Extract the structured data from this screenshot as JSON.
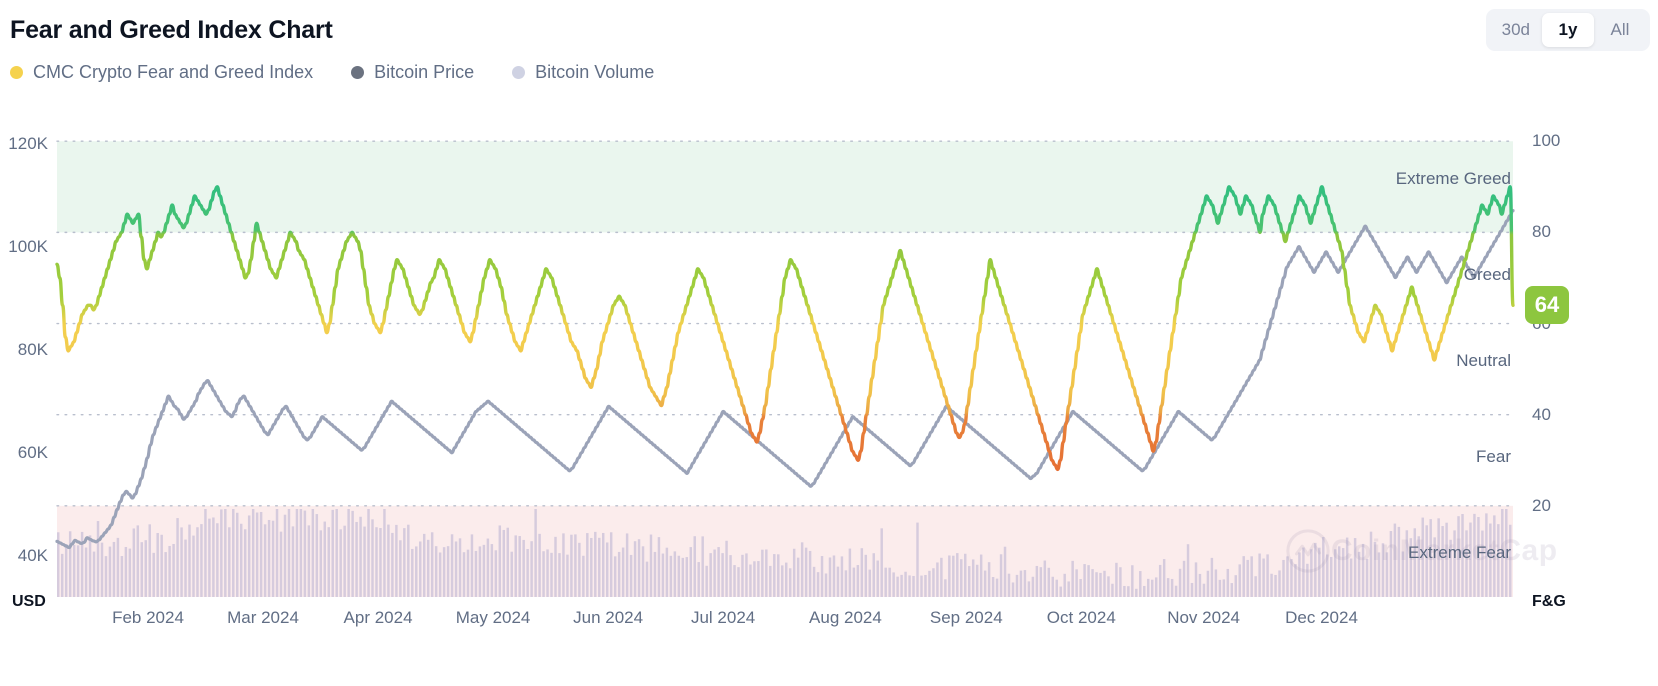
{
  "header": {
    "title": "Fear and Greed Index Chart"
  },
  "range_switch": {
    "options": [
      {
        "label": "30d",
        "active": false
      },
      {
        "label": "1y",
        "active": true
      },
      {
        "label": "All",
        "active": false
      }
    ]
  },
  "legend": {
    "items": [
      {
        "label": "CMC Crypto Fear and Greed Index",
        "color": "#f5d24e",
        "icon": "legend-dot-icon"
      },
      {
        "label": "Bitcoin Price",
        "color": "#6b7280",
        "icon": "legend-dot-icon"
      },
      {
        "label": "Bitcoin Volume",
        "color": "#cfd2e3",
        "icon": "legend-dot-icon"
      }
    ]
  },
  "current_value": {
    "value": "64",
    "badge_color": "#8dc63f"
  },
  "watermark": {
    "text": "CoinMarketCap"
  },
  "axes": {
    "left_unit": "USD",
    "right_unit": "F&G"
  },
  "chart_data": {
    "type": "line",
    "title": "Fear and Greed Index Chart",
    "xlabel": "",
    "ylabel": "USD",
    "y2label": "F&G",
    "grid": true,
    "legend_position": "top-left",
    "x_tick_labels": [
      "Feb 2024",
      "Mar 2024",
      "Apr 2024",
      "May 2024",
      "Jun 2024",
      "Jul 2024",
      "Aug 2024",
      "Sep 2024",
      "Oct 2024",
      "Nov 2024",
      "Dec 2024"
    ],
    "x_tick_fracs": [
      0.0625,
      0.1415,
      0.2205,
      0.2995,
      0.3785,
      0.4575,
      0.5415,
      0.6245,
      0.7035,
      0.7875,
      0.8685
    ],
    "y_left_ticks": [
      "120K",
      "100K",
      "80K",
      "60K",
      "40K"
    ],
    "y_left_values": [
      120000,
      100000,
      80000,
      60000,
      40000
    ],
    "y_left_lim": [
      32000,
      124000
    ],
    "y_right_ticks": [
      "100",
      "80",
      "60",
      "40",
      "20"
    ],
    "y_right_values": [
      100,
      80,
      60,
      40,
      20
    ],
    "y_right_lim": [
      0,
      104
    ],
    "zones": [
      {
        "label": "Extreme Greed",
        "range": [
          80,
          100
        ],
        "band_color": "#eaf6ee",
        "line_color": "#3cb878"
      },
      {
        "label": "Greed",
        "range": [
          60,
          80
        ],
        "band_color": "",
        "line_color": "#8dc63f"
      },
      {
        "label": "Neutral",
        "range": [
          40,
          60
        ],
        "band_color": "",
        "line_color": "#f3d04e"
      },
      {
        "label": "Fear",
        "range": [
          20,
          40
        ],
        "band_color": "",
        "line_color": "#e8833a"
      },
      {
        "label": "Extreme Fear",
        "range": [
          0,
          20
        ],
        "band_color": "#fbecec",
        "line_color": "#ea3943"
      }
    ],
    "series": [
      {
        "name": "CMC Crypto Fear and Greed Index",
        "axis": "right",
        "type": "line",
        "color_mode": "zone-gradient",
        "values": [
          73,
          70,
          64,
          57,
          54,
          55,
          56,
          58,
          60,
          62,
          63,
          64,
          64,
          63,
          64,
          66,
          68,
          70,
          72,
          74,
          76,
          78,
          79,
          80,
          82,
          84,
          83,
          82,
          83,
          84,
          79,
          74,
          72,
          74,
          76,
          78,
          80,
          79,
          80,
          82,
          84,
          86,
          84,
          83,
          82,
          81,
          82,
          84,
          86,
          88,
          87,
          86,
          85,
          84,
          85,
          87,
          89,
          90,
          88,
          86,
          84,
          82,
          80,
          78,
          76,
          74,
          72,
          70,
          71,
          74,
          78,
          82,
          80,
          78,
          76,
          74,
          72,
          71,
          70,
          72,
          74,
          76,
          78,
          80,
          79,
          78,
          76,
          75,
          74,
          72,
          70,
          68,
          66,
          64,
          62,
          60,
          58,
          60,
          64,
          68,
          72,
          74,
          76,
          78,
          79,
          80,
          79,
          78,
          76,
          72,
          68,
          64,
          62,
          60,
          59,
          58,
          60,
          63,
          66,
          69,
          72,
          74,
          73,
          72,
          70,
          68,
          66,
          64,
          63,
          62,
          63,
          65,
          67,
          69,
          70,
          72,
          74,
          73,
          72,
          70,
          68,
          66,
          64,
          62,
          60,
          58,
          57,
          56,
          58,
          61,
          64,
          67,
          70,
          72,
          74,
          73,
          72,
          70,
          68,
          65,
          62,
          60,
          58,
          56,
          55,
          54,
          56,
          58,
          60,
          62,
          64,
          66,
          68,
          70,
          72,
          71,
          70,
          68,
          66,
          64,
          62,
          60,
          58,
          56,
          55,
          54,
          52,
          50,
          48,
          47,
          46,
          48,
          50,
          53,
          56,
          58,
          60,
          62,
          64,
          65,
          66,
          65,
          64,
          62,
          60,
          58,
          56,
          54,
          52,
          50,
          48,
          46,
          45,
          44,
          43,
          42,
          44,
          46,
          49,
          52,
          55,
          58,
          60,
          62,
          64,
          66,
          68,
          70,
          72,
          71,
          70,
          68,
          66,
          64,
          62,
          60,
          58,
          56,
          54,
          52,
          50,
          48,
          46,
          44,
          42,
          40,
          38,
          36,
          35,
          34,
          36,
          39,
          42,
          46,
          50,
          54,
          58,
          62,
          66,
          70,
          72,
          74,
          73,
          72,
          70,
          68,
          66,
          64,
          62,
          60,
          58,
          56,
          54,
          52,
          50,
          48,
          46,
          44,
          42,
          40,
          38,
          36,
          34,
          32,
          31,
          30,
          32,
          36,
          40,
          44,
          48,
          52,
          56,
          60,
          64,
          66,
          68,
          70,
          72,
          74,
          76,
          74,
          72,
          70,
          68,
          66,
          64,
          62,
          60,
          58,
          56,
          54,
          52,
          50,
          48,
          46,
          44,
          42,
          40,
          38,
          36,
          35,
          36,
          38,
          42,
          46,
          50,
          54,
          58,
          62,
          66,
          70,
          74,
          72,
          70,
          68,
          66,
          64,
          62,
          60,
          58,
          56,
          54,
          52,
          50,
          48,
          46,
          44,
          42,
          40,
          38,
          36,
          34,
          32,
          30,
          29,
          28,
          30,
          34,
          38,
          42,
          46,
          50,
          54,
          58,
          62,
          64,
          66,
          68,
          70,
          72,
          70,
          68,
          66,
          64,
          62,
          60,
          58,
          56,
          54,
          52,
          50,
          48,
          46,
          44,
          42,
          40,
          38,
          36,
          34,
          32,
          34,
          38,
          42,
          46,
          50,
          54,
          58,
          62,
          66,
          70,
          72,
          74,
          76,
          78,
          80,
          82,
          84,
          86,
          88,
          87,
          86,
          84,
          82,
          84,
          86,
          88,
          90,
          89,
          88,
          86,
          84,
          86,
          88,
          87,
          86,
          84,
          82,
          80,
          84,
          86,
          88,
          87,
          86,
          84,
          82,
          80,
          78,
          80,
          82,
          84,
          86,
          88,
          87,
          86,
          84,
          82,
          84,
          86,
          88,
          90,
          88,
          86,
          84,
          82,
          80,
          78,
          76,
          72,
          68,
          64,
          62,
          60,
          58,
          57,
          56,
          58,
          60,
          62,
          64,
          63,
          62,
          60,
          58,
          56,
          54,
          56,
          58,
          60,
          62,
          64,
          66,
          68,
          66,
          64,
          62,
          60,
          58,
          56,
          54,
          52,
          54,
          56,
          58,
          60,
          62,
          64,
          66,
          68,
          70,
          72,
          74,
          76,
          78,
          80,
          82,
          84,
          86,
          85,
          84,
          86,
          88,
          87,
          86,
          84,
          86,
          88,
          90,
          64
        ]
      },
      {
        "name": "Bitcoin Price",
        "axis": "left",
        "type": "line",
        "color": "#9ba3b8",
        "values": [
          42800,
          42500,
          42200,
          41900,
          41600,
          42300,
          43000,
          42700,
          42400,
          42600,
          43500,
          43200,
          42900,
          42700,
          43100,
          43800,
          44500,
          45200,
          46000,
          47500,
          49000,
          50500,
          51800,
          52500,
          51900,
          51200,
          52000,
          53500,
          55000,
          57000,
          59000,
          61500,
          63500,
          65000,
          66500,
          68000,
          69500,
          71000,
          70000,
          69000,
          68500,
          67500,
          66500,
          67000,
          68000,
          69000,
          70000,
          71500,
          72500,
          73500,
          74000,
          73000,
          72000,
          71000,
          70000,
          69000,
          68000,
          67500,
          67000,
          68000,
          69500,
          70500,
          71000,
          70000,
          69000,
          68000,
          67000,
          66000,
          65000,
          64000,
          63500,
          64500,
          65500,
          66500,
          67500,
          68500,
          69000,
          68000,
          67000,
          66000,
          65000,
          64000,
          63000,
          62500,
          63000,
          64000,
          65000,
          66000,
          67000,
          66500,
          66000,
          65500,
          65000,
          64500,
          64000,
          63500,
          63000,
          62500,
          62000,
          61500,
          61000,
          60500,
          61000,
          62000,
          63000,
          64000,
          65000,
          66000,
          67000,
          68000,
          69000,
          70000,
          69500,
          69000,
          68500,
          68000,
          67500,
          67000,
          66500,
          66000,
          65500,
          65000,
          64500,
          64000,
          63500,
          63000,
          62500,
          62000,
          61500,
          61000,
          60500,
          60000,
          61000,
          62000,
          63000,
          64000,
          65000,
          66000,
          67000,
          68000,
          68500,
          69000,
          69500,
          70000,
          69500,
          69000,
          68500,
          68000,
          67500,
          67000,
          66500,
          66000,
          65500,
          65000,
          64500,
          64000,
          63500,
          63000,
          62500,
          62000,
          61500,
          61000,
          60500,
          60000,
          59500,
          59000,
          58500,
          58000,
          57500,
          57000,
          56500,
          57000,
          58000,
          59000,
          60000,
          61000,
          62000,
          63000,
          64000,
          65000,
          66000,
          67000,
          68000,
          69000,
          68500,
          68000,
          67500,
          67000,
          66500,
          66000,
          65500,
          65000,
          64500,
          64000,
          63500,
          63000,
          62500,
          62000,
          61500,
          61000,
          60500,
          60000,
          59500,
          59000,
          58500,
          58000,
          57500,
          57000,
          56500,
          56000,
          57000,
          58000,
          59000,
          60000,
          61000,
          62000,
          63000,
          64000,
          65000,
          66000,
          67000,
          68000,
          67500,
          67000,
          66500,
          66000,
          65500,
          65000,
          64500,
          64000,
          63500,
          63000,
          62500,
          62000,
          61500,
          61000,
          60500,
          60000,
          59500,
          59000,
          58500,
          58000,
          57500,
          57000,
          56500,
          56000,
          55500,
          55000,
          54500,
          54000,
          53500,
          54000,
          55000,
          56000,
          57000,
          58000,
          59000,
          60000,
          61000,
          62000,
          63000,
          64000,
          65000,
          66000,
          67000,
          66500,
          66000,
          65500,
          65000,
          64500,
          64000,
          63500,
          63000,
          62500,
          62000,
          61500,
          61000,
          60500,
          60000,
          59500,
          59000,
          58500,
          58000,
          57500,
          58000,
          59000,
          60000,
          61000,
          62000,
          63000,
          64000,
          65000,
          66000,
          67000,
          68000,
          69000,
          68500,
          68000,
          67500,
          67000,
          66500,
          66000,
          65500,
          65000,
          64500,
          64000,
          63500,
          63000,
          62500,
          62000,
          61500,
          61000,
          60500,
          60000,
          59500,
          59000,
          58500,
          58000,
          57500,
          57000,
          56500,
          56000,
          55500,
          55000,
          55500,
          56000,
          57000,
          58000,
          59000,
          60000,
          61000,
          62000,
          63000,
          64000,
          65000,
          66000,
          67000,
          68000,
          67500,
          67000,
          66500,
          66000,
          65500,
          65000,
          64500,
          64000,
          63500,
          63000,
          62500,
          62000,
          61500,
          61000,
          60500,
          60000,
          59500,
          59000,
          58500,
          58000,
          57500,
          57000,
          56500,
          57000,
          58000,
          59000,
          60000,
          61000,
          62000,
          63000,
          64000,
          65000,
          66000,
          67000,
          68000,
          67500,
          67000,
          66500,
          66000,
          65500,
          65000,
          64500,
          64000,
          63500,
          63000,
          62500,
          63000,
          64000,
          65000,
          66000,
          67000,
          68000,
          69000,
          70000,
          71000,
          72000,
          73000,
          74000,
          75000,
          76000,
          77000,
          78000,
          80000,
          82000,
          84000,
          86000,
          88000,
          90000,
          92000,
          94000,
          96000,
          97000,
          98000,
          99000,
          100000,
          99000,
          98000,
          97000,
          96000,
          95000,
          96000,
          97000,
          98000,
          99000,
          98000,
          97000,
          96000,
          95000,
          96000,
          97000,
          98000,
          99000,
          100000,
          101000,
          102000,
          103000,
          104000,
          103000,
          102000,
          101000,
          100000,
          99000,
          98000,
          97000,
          96000,
          95000,
          94000,
          95000,
          96000,
          97000,
          98000,
          97000,
          96000,
          95000,
          96000,
          97000,
          98000,
          99000,
          98000,
          97000,
          96000,
          95000,
          94000,
          93000,
          94000,
          95000,
          96000,
          97000,
          98000,
          97000,
          96000,
          95000,
          94000,
          95000,
          96000,
          97000,
          98000,
          99000,
          100000,
          101000,
          102000,
          103000,
          104000,
          105000,
          106000,
          107000
        ]
      },
      {
        "name": "Bitcoin Volume",
        "axis": "volume",
        "type": "bar",
        "color": "#cfc6da"
      }
    ]
  }
}
